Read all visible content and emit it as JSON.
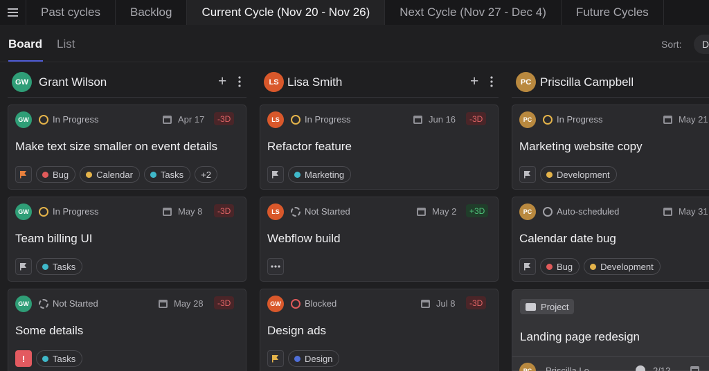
{
  "top_tabs": [
    "Past cycles",
    "Backlog",
    "Current Cycle (Nov 20 - Nov 26)",
    "Next Cycle (Nov 27 - Dec 4)",
    "Future Cycles"
  ],
  "view_tabs": [
    "Board",
    "List"
  ],
  "sort": {
    "label": "Sort:",
    "value": "D"
  },
  "columns": [
    {
      "name": "Grant Wilson",
      "initials": "GW",
      "color": "#2f9e77",
      "cards": [
        {
          "initials": "GW",
          "status": "In Progress",
          "date": "Apr 17",
          "badge": "-3D",
          "title": "Make text size smaller on event details",
          "tags": [
            "Bug",
            "Calendar",
            "Tasks"
          ],
          "extra": "+2"
        },
        {
          "initials": "GW",
          "status": "In Progress",
          "date": "May 8",
          "badge": "-3D",
          "title": "Team billing UI",
          "tags": [
            "Tasks"
          ]
        },
        {
          "initials": "GW",
          "status": "Not Started",
          "date": "May 28",
          "badge": "-3D",
          "title": "Some details",
          "tags": [
            "Tasks"
          ]
        }
      ]
    },
    {
      "name": "Lisa Smith",
      "initials": "LS",
      "color": "#d9582b",
      "cards": [
        {
          "initials": "LS",
          "status": "In Progress",
          "date": "Jun 16",
          "badge": "-3D",
          "title": "Refactor feature",
          "tags": [
            "Marketing"
          ]
        },
        {
          "initials": "LS",
          "status": "Not Started",
          "date": "May 2",
          "badge": "+3D",
          "title": "Webflow build",
          "tags": []
        },
        {
          "initials": "GW",
          "status": "Blocked",
          "date": "Jul 8",
          "badge": "-3D",
          "title": "Design ads",
          "tags": [
            "Design"
          ]
        }
      ]
    },
    {
      "name": "Priscilla Campbell",
      "initials": "PC",
      "color": "#b9893f",
      "cards": [
        {
          "initials": "PC",
          "status": "In Progress",
          "date": "May 21",
          "title": "Marketing website copy",
          "tags": [
            "Development"
          ]
        },
        {
          "initials": "PC",
          "status": "Auto-scheduled",
          "date": "May 31",
          "title": "Calendar date bug",
          "tags": [
            "Bug",
            "Development"
          ]
        }
      ],
      "project": {
        "label": "Project",
        "title": "Landing page redesign",
        "owner_initials": "PC",
        "owner": "Priscilla Lo",
        "count": "2/12"
      }
    }
  ],
  "colors": {
    "accent": "#4f5bd5",
    "tag_bug": "#e05a5a",
    "tag_calendar": "#e4b34a",
    "tag_tasks": "#3fb8c9",
    "tag_marketing": "#3fb8c9",
    "tag_development": "#e4b34a",
    "tag_design": "#4f6fd9"
  }
}
